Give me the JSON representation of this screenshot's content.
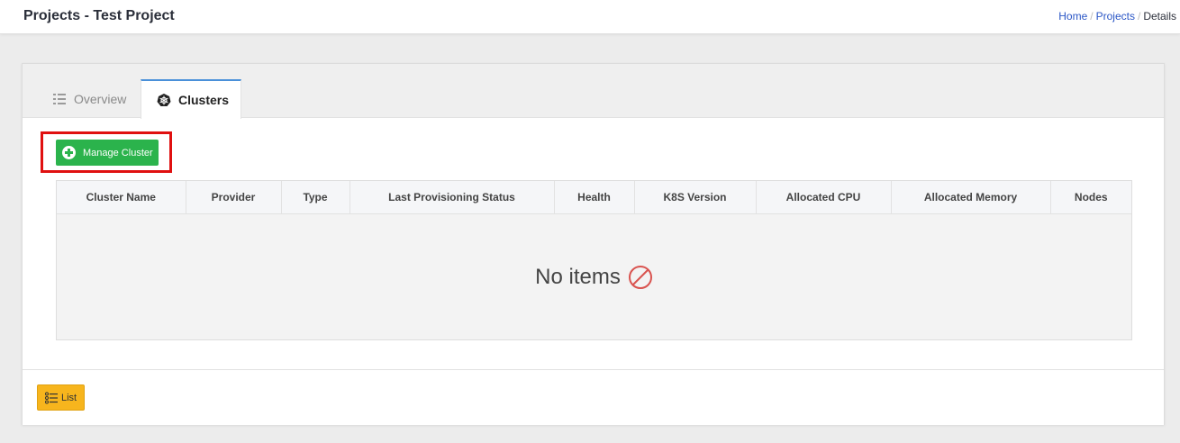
{
  "header": {
    "title": "Projects - Test Project",
    "breadcrumb": [
      {
        "label": "Home"
      },
      {
        "label": "Projects"
      },
      {
        "label": "Details"
      }
    ],
    "separator": "/"
  },
  "tabs": [
    {
      "label": "Overview",
      "icon": "list-icon",
      "active": false
    },
    {
      "label": "Clusters",
      "icon": "kubernetes-icon",
      "active": true
    }
  ],
  "actions": {
    "manage_cluster_label": "Manage Cluster",
    "manage_cluster_color": "#2bb34c",
    "highlight_color": "#e01010"
  },
  "table": {
    "columns": [
      "Cluster Name",
      "Provider",
      "Type",
      "Last Provisioning Status",
      "Health",
      "K8S Version",
      "Allocated CPU",
      "Allocated Memory",
      "Nodes"
    ],
    "empty_text": "No items",
    "empty_icon": "ban-icon",
    "empty_icon_color": "#d9534f"
  },
  "footer": {
    "list_label": "List",
    "list_color": "#f7b51d"
  }
}
